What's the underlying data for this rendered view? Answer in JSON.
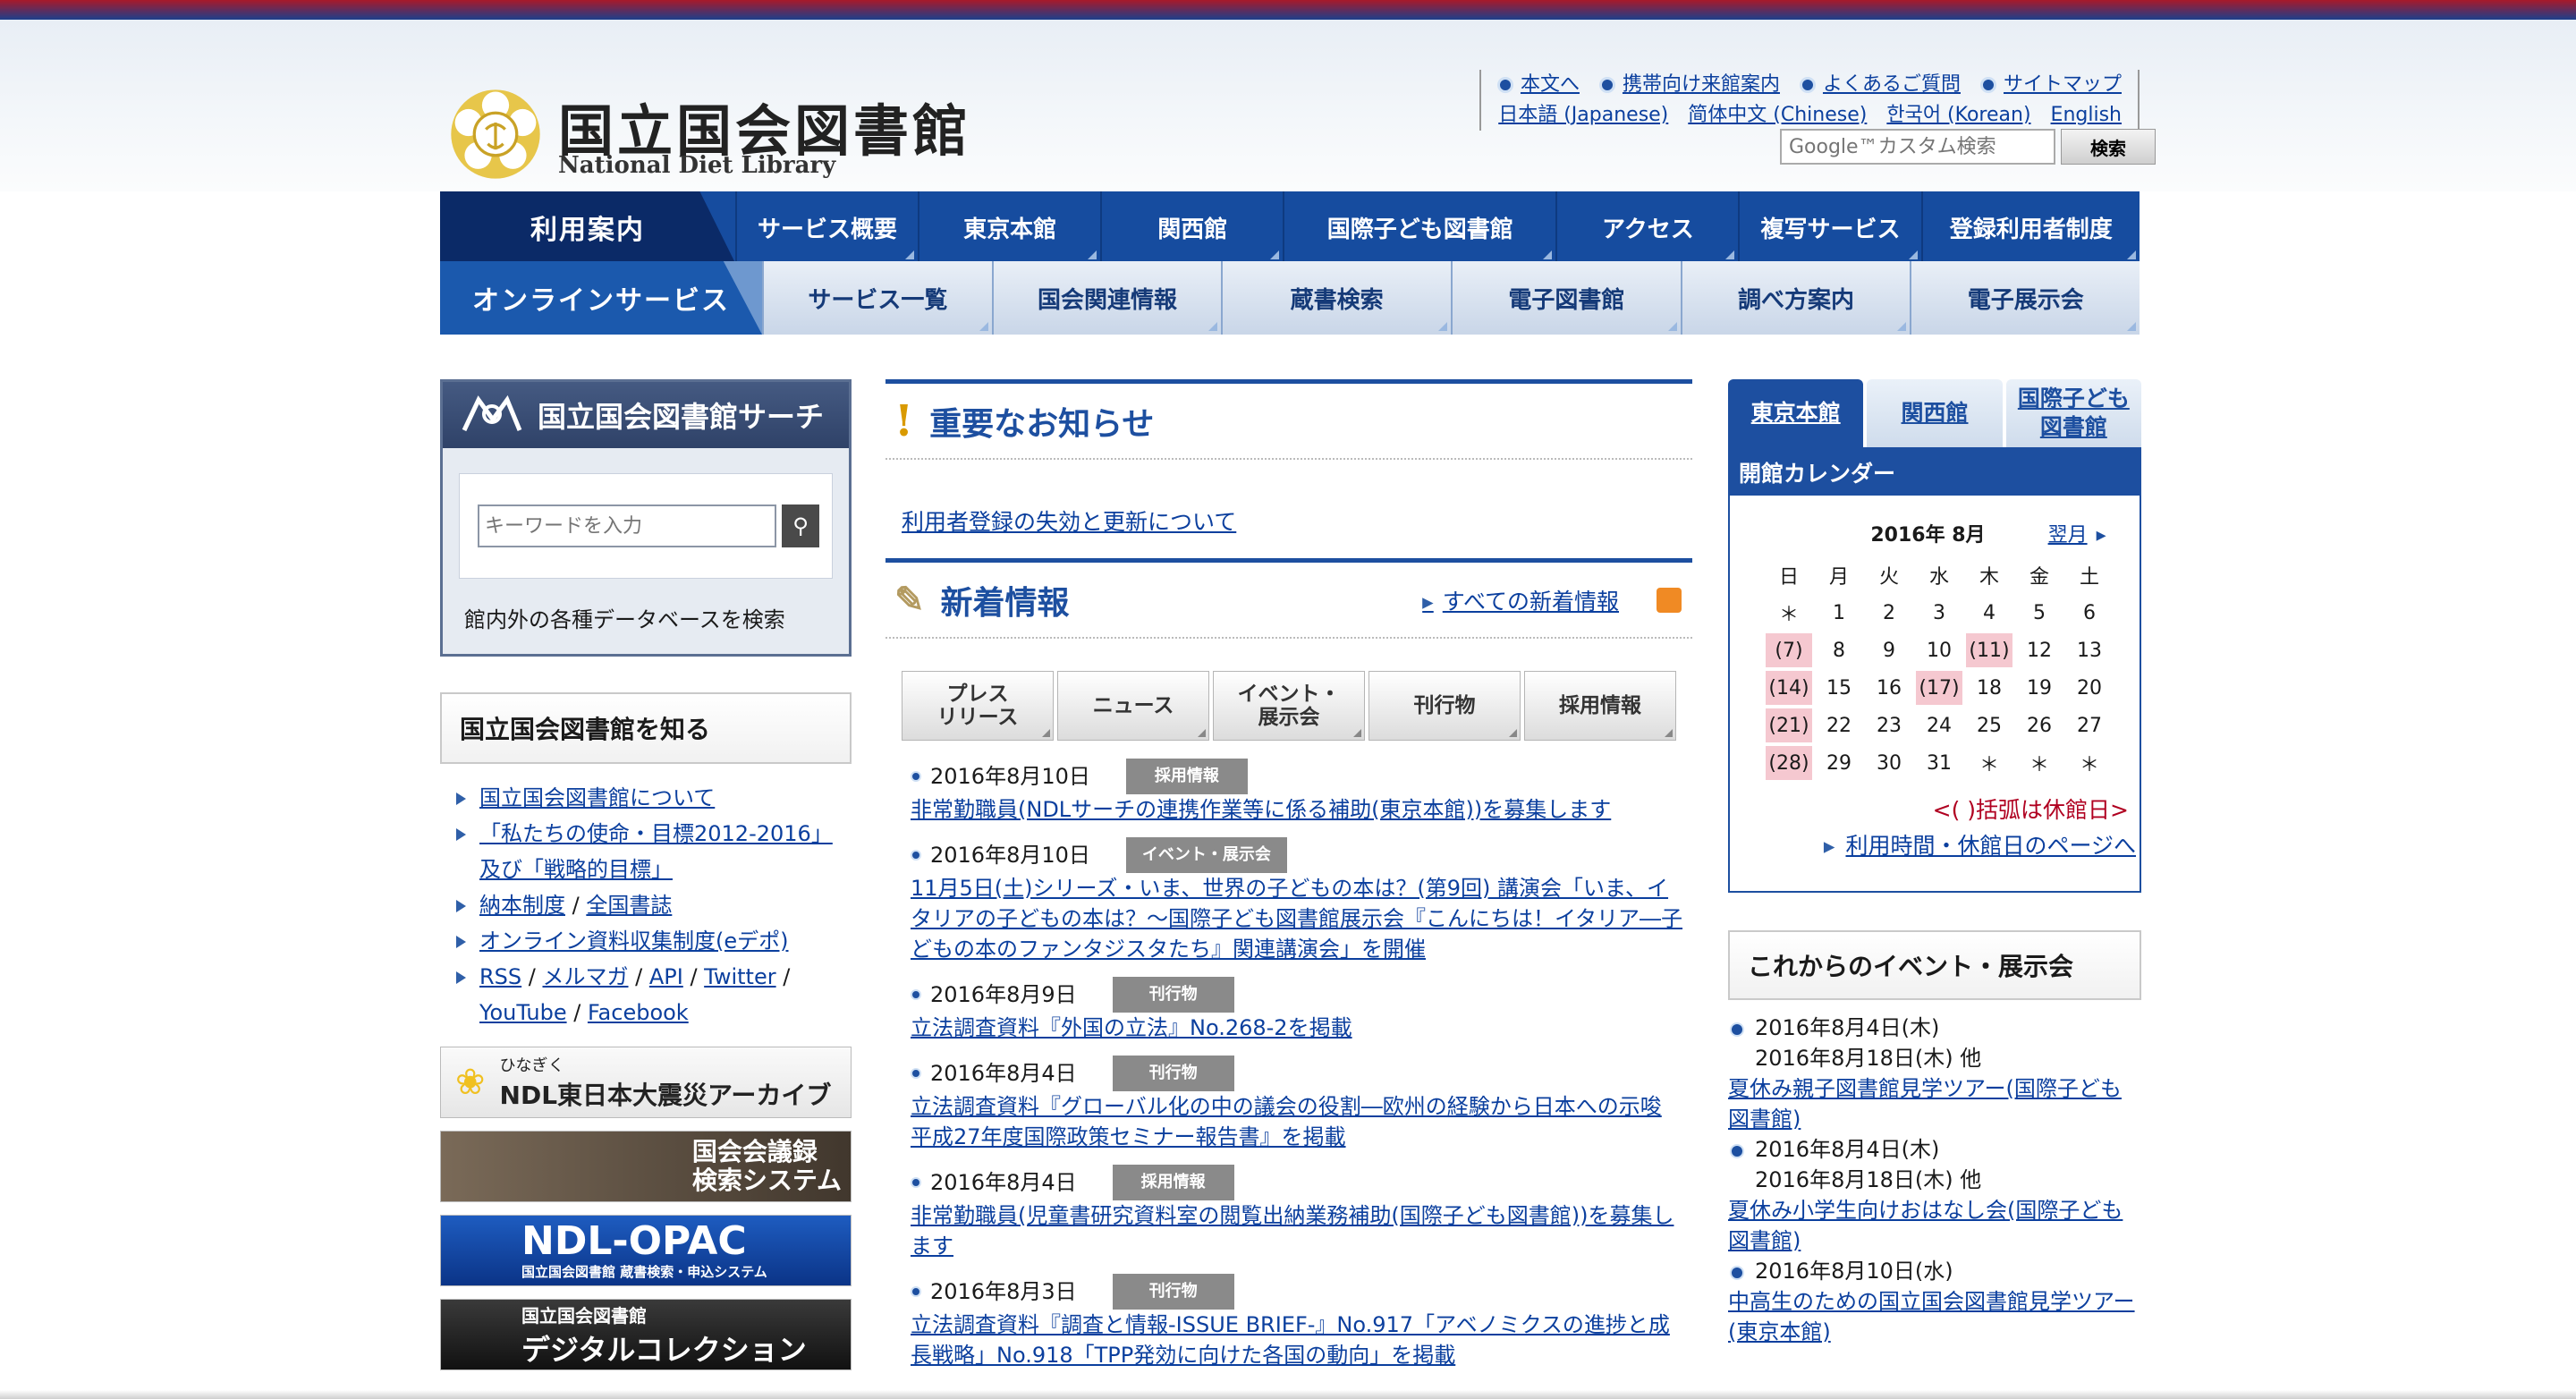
{
  "brand": {
    "name_ja": "国立国会図書館",
    "name_en": "National Diet Library"
  },
  "utility": {
    "row1": [
      "本文へ",
      "携帯向け来館案内",
      "よくあるご質問",
      "サイトマップ"
    ],
    "row2": [
      "日本語 (Japanese)",
      "简体中文 (Chinese)",
      "한국어 (Korean)",
      "English"
    ]
  },
  "site_search": {
    "placeholder": "Google™カスタム検索",
    "button": "検索"
  },
  "nav1": {
    "lead": "利用案内",
    "items": [
      "サービス概要",
      "東京本館",
      "関西館",
      "国際子ども図書館",
      "アクセス",
      "複写サービス",
      "登録利用者制度"
    ]
  },
  "nav2": {
    "lead": "オンラインサービス",
    "items": [
      "サービス一覧",
      "国会関連情報",
      "蔵書検索",
      "電子図書館",
      "調べ方案内",
      "電子展示会"
    ]
  },
  "ndl_search": {
    "title": "国立国会図書館サーチ",
    "placeholder": "キーワードを入力",
    "desc": "館内外の各種データベースを検索"
  },
  "know": {
    "title": "国立国会図書館を知る",
    "links": [
      [
        "国立国会図書館について"
      ],
      [
        "「私たちの使命・目標2012-2016」及び「戦略的目標」"
      ],
      [
        "納本制度",
        "全国書誌"
      ],
      [
        "オンライン資料収集制度(eデポ)"
      ],
      [
        "RSS",
        "メルマガ",
        "API",
        "Twitter",
        "YouTube",
        "Facebook"
      ]
    ]
  },
  "banners": {
    "b1_small": "ひなぎく",
    "b1": "NDL東日本大震災アーカイブ",
    "b2_1": "国会会議録",
    "b2_2": "検索システム",
    "b3_1": "NDL-OPAC",
    "b3_2": "国立国会図書館 蔵書検索・申込システム",
    "b4_1": "国立国会図書館",
    "b4_2": "デジタルコレクション"
  },
  "important": {
    "title": "重要なお知らせ",
    "link": "利用者登録の失効と更新について"
  },
  "whatsnew": {
    "title": "新着情報",
    "more": "すべての新着情報",
    "tabs": [
      "プレス\nリリース",
      "ニュース",
      "イベント・\n展示会",
      "刊行物",
      "採用情報"
    ],
    "items": [
      {
        "date": "2016年8月10日",
        "tag": "採用情報",
        "text": "非常勤職員(NDLサーチの連携作業等に係る補助(東京本館))を募集します"
      },
      {
        "date": "2016年8月10日",
        "tag": "イベント・展示会",
        "text": "11月5日(土)シリーズ・いま、世界の子どもの本は？(第9回) 講演会「いま、イタリアの子どもの本は？～国際子ども図書館展示会『こんにちは！イタリア―子どもの本のファンタジスタたち』関連講演会」を開催"
      },
      {
        "date": "2016年8月9日",
        "tag": "刊行物",
        "text": "立法調査資料『外国の立法』No.268-2を掲載"
      },
      {
        "date": "2016年8月4日",
        "tag": "刊行物",
        "text": "立法調査資料『グローバル化の中の議会の役割―欧州の経験から日本への示唆 平成27年度国際政策セミナー報告書』を掲載"
      },
      {
        "date": "2016年8月4日",
        "tag": "採用情報",
        "text": "非常勤職員(児童書研究資料室の閲覧出納業務補助(国際子ども図書館))を募集します"
      },
      {
        "date": "2016年8月3日",
        "tag": "刊行物",
        "text": "立法調査資料『調査と情報-ISSUE BRIEF-』No.917「アベノミクスの進捗と成長戦略」No.918「TPP発効に向けた各国の動向」を掲載"
      }
    ]
  },
  "calendar": {
    "tabs": [
      "東京本館",
      "関西館",
      "国際子ども\n図書館"
    ],
    "title": "開館カレンダー",
    "month": "2016年 8月",
    "next": "翌月",
    "weekdays": [
      "日",
      "月",
      "火",
      "水",
      "木",
      "金",
      "土"
    ],
    "rows": [
      [
        "＊",
        "1",
        "2",
        "3",
        "4",
        "5",
        "6"
      ],
      [
        "(7)",
        "8",
        "9",
        "10",
        "(11)",
        "12",
        "13"
      ],
      [
        "(14)",
        "15",
        "16",
        "(17)",
        "18",
        "19",
        "20"
      ],
      [
        "(21)",
        "22",
        "23",
        "24",
        "25",
        "26",
        "27"
      ],
      [
        "(28)",
        "29",
        "30",
        "31",
        "＊",
        "＊",
        "＊"
      ]
    ],
    "note": "<( )括弧は休館日>",
    "link": "利用時間・休館日のページへ"
  },
  "events": {
    "title": "これからのイベント・展示会",
    "items": [
      {
        "date1": "2016年8月4日(木)",
        "date2": "2016年8月18日(木) 他",
        "text": "夏休み親子図書館見学ツアー(国際子ども図書館)"
      },
      {
        "date1": "2016年8月4日(木)",
        "date2": "2016年8月18日(木) 他",
        "text": "夏休み小学生向けおはなし会(国際子ども図書館)"
      },
      {
        "date1": "2016年8月10日(水)",
        "date2": "",
        "text": "中高生のための国立国会図書館見学ツアー(東京本館)"
      }
    ]
  },
  "colors": {
    "primary": "#1d4fa0",
    "nav_dark": "#0b2a67",
    "holiday": "#f5c8d0",
    "notice_red": "#b00020"
  }
}
